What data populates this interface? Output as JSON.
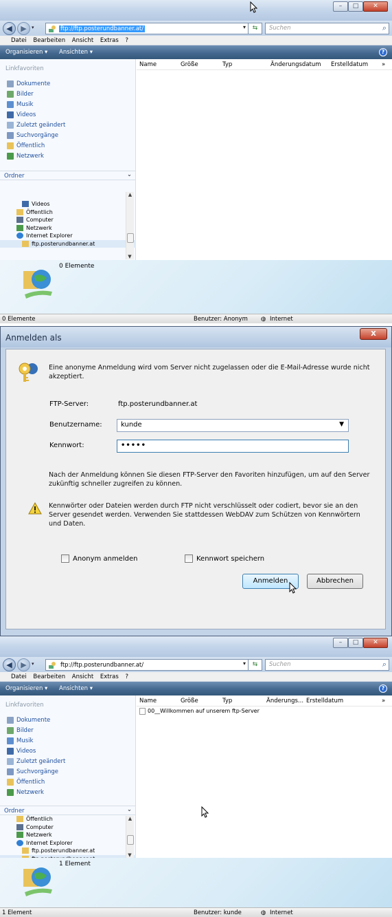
{
  "window_top": {
    "address_url": "ftp://ftp.posterundbanner.at/",
    "search_placeholder": "Suchen",
    "menu": [
      "Datei",
      "Bearbeiten",
      "Ansicht",
      "Extras",
      "?"
    ],
    "commands": [
      "Organisieren ▾",
      "Ansichten ▾"
    ],
    "linkfavoriten_title": "Linkfavoriten",
    "linkfavoriten": [
      "Dokumente",
      "Bilder",
      "Musik",
      "Videos",
      "Zuletzt geändert",
      "Suchvorgänge",
      "Öffentlich",
      "Netzwerk"
    ],
    "ordner_label": "Ordner",
    "tree_items": [
      "Videos",
      "Öffentlich",
      "Computer",
      "Netzwerk",
      "Internet Explorer",
      "ftp.posterundbanner.at"
    ],
    "columns": [
      "Name",
      "Größe",
      "Typ",
      "Änderungsdatum",
      "Erstelldatum",
      "»"
    ],
    "details_count": "0 Elemente",
    "status_left": "0 Elemente",
    "status_user": "Benutzer: Anonym",
    "status_zone": "Internet"
  },
  "dialog": {
    "title": "Anmelden als",
    "close_label": "X",
    "message": "Eine anonyme Anmeldung wird vom Server nicht zugelassen oder die E-Mail-Adresse wurde nicht akzeptiert.",
    "ftp_server_label": "FTP-Server:",
    "ftp_server_value": "ftp.posterundbanner.at",
    "username_label": "Benutzername:",
    "username_value": "kunde",
    "password_label": "Kennwort:",
    "password_value": "•••••",
    "favorites_text": "Nach der Anmeldung können Sie diesen FTP-Server den Favoriten hinzufügen, um auf den Server zukünftig schneller zugreifen zu können.",
    "warning_text": "Kennwörter oder Dateien werden durch FTP nicht verschlüsselt oder codiert, bevor sie an den Server gesendet werden. Verwenden Sie stattdessen WebDAV zum Schützen von Kennwörtern und Daten.",
    "anonymous_label": "Anonym anmelden",
    "save_password_label": "Kennwort speichern",
    "login_button": "Anmelden",
    "cancel_button": "Abbrechen"
  },
  "window_bottom": {
    "address_url": "ftp://ftp.posterundbanner.at/",
    "search_placeholder": "Suchen",
    "menu": [
      "Datei",
      "Bearbeiten",
      "Ansicht",
      "Extras",
      "?"
    ],
    "commands": [
      "Organisieren ▾",
      "Ansichten ▾"
    ],
    "linkfavoriten_title": "Linkfavoriten",
    "linkfavoriten": [
      "Dokumente",
      "Bilder",
      "Musik",
      "Videos",
      "Zuletzt geändert",
      "Suchvorgänge",
      "Öffentlich",
      "Netzwerk"
    ],
    "ordner_label": "Ordner",
    "tree_items": [
      "Öffentlich",
      "Computer",
      "Netzwerk",
      "Internet Explorer",
      "ftp.posterundbanner.at",
      "ftp.posterundbanner.at"
    ],
    "columns": [
      "Name",
      "Größe",
      "Typ",
      "Änderungs...",
      "Erstelldatum",
      "»"
    ],
    "file_name": "00__Willkommen auf unserem ftp-Server",
    "details_count": "1 Element",
    "status_left": "1 Element",
    "status_user": "Benutzer: kunde",
    "status_zone": "Internet"
  },
  "icon_colors": {
    "folder": "#e9c35a",
    "doc": "#6a8cc0",
    "globe": "#3a8fd6",
    "accent": "#3399ff"
  }
}
